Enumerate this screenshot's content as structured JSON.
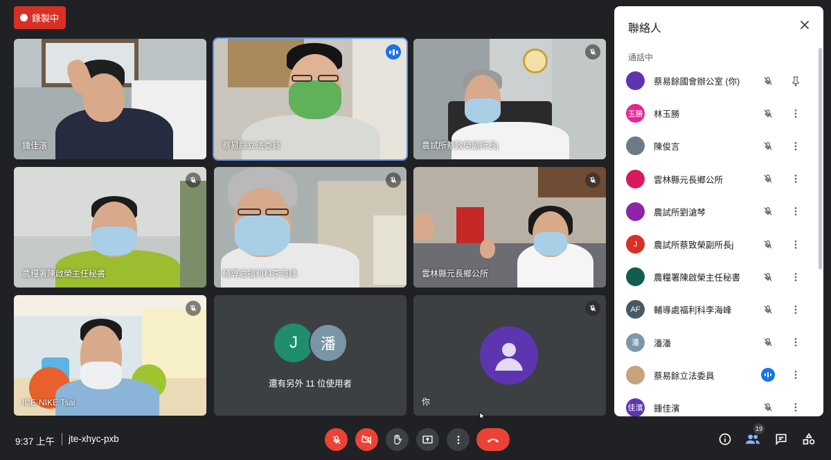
{
  "recording": {
    "label": "錄製中"
  },
  "tiles": [
    {
      "name": "鍾佳濱"
    },
    {
      "name": "蔡易餘立法委員"
    },
    {
      "name": "農試所蔡致榮副所長j"
    },
    {
      "name": "農糧署陳啟榮主任秘書"
    },
    {
      "name": "輔導處福利科李海峰"
    },
    {
      "name": "雲林縣元長鄉公所"
    },
    {
      "name": "ICE-NIKE Tsai"
    },
    {
      "name": "還有另外 11 位使用者",
      "avatar1": "J",
      "avatar2": "潘"
    },
    {
      "name": "你"
    }
  ],
  "panel": {
    "title": "聯絡人",
    "section": "通話中",
    "people": [
      {
        "name": "蔡易餘國會辦公室 (你)",
        "initials": "",
        "color": "#5e35b1"
      },
      {
        "name": "林玉勝",
        "initials": "玉勝",
        "color": "#e52592"
      },
      {
        "name": "陳俊言",
        "initials": "",
        "color": "#6d7b86"
      },
      {
        "name": "雲林縣元長鄉公所",
        "initials": "",
        "color": "#d81b60"
      },
      {
        "name": "農試所劉滄棽",
        "initials": "",
        "color": "#8e24aa"
      },
      {
        "name": "農試所蔡致榮副所長j",
        "initials": "J",
        "color": "#d93025"
      },
      {
        "name": "農糧署陳啟榮主任秘書",
        "initials": "",
        "color": "#0f5e4e"
      },
      {
        "name": "輔導處福利科李海峰",
        "initials": "AF",
        "color": "#455a64"
      },
      {
        "name": "潘潘",
        "initials": "潘",
        "color": "#7b97ab"
      },
      {
        "name": "蔡易餘立法委員",
        "initials": "",
        "color": "#c9a27a"
      },
      {
        "name": "鍾佳濱",
        "initials": "佳濱",
        "color": "#5e35b1"
      }
    ]
  },
  "bottom": {
    "time": "9:37 上午",
    "meeting_code": "jte-xhyc-pxb",
    "participants_count": "19"
  }
}
